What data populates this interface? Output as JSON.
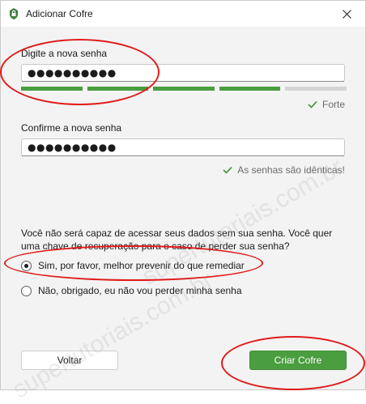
{
  "window": {
    "title": "Adicionar Cofre"
  },
  "new_password": {
    "label": "Digite a nova senha",
    "value": "●●●●●●●●●●",
    "strength_segments_filled": 4,
    "strength_segments_total": 5,
    "strength_text": "Forte"
  },
  "confirm_password": {
    "label": "Confirme a nova senha",
    "value": "●●●●●●●●●●",
    "match_text": "As senhas são idênticas!"
  },
  "recovery": {
    "description": "Você não será capaz de acessar seus dados sem sua senha. Você quer uma chave de recuperação para o caso de perder sua senha?",
    "options": [
      {
        "label": "Sim, por favor, melhor prevenir do que remediar",
        "selected": true
      },
      {
        "label": "Não, obrigado, eu não vou perder minha senha",
        "selected": false
      }
    ]
  },
  "buttons": {
    "back": "Voltar",
    "create": "Criar Cofre"
  },
  "watermark": "supertutoriais.com.br",
  "colors": {
    "accent_green": "#4a9e3f",
    "annotation_red": "#e01b1b",
    "strength_empty": "#d4d4d4"
  }
}
